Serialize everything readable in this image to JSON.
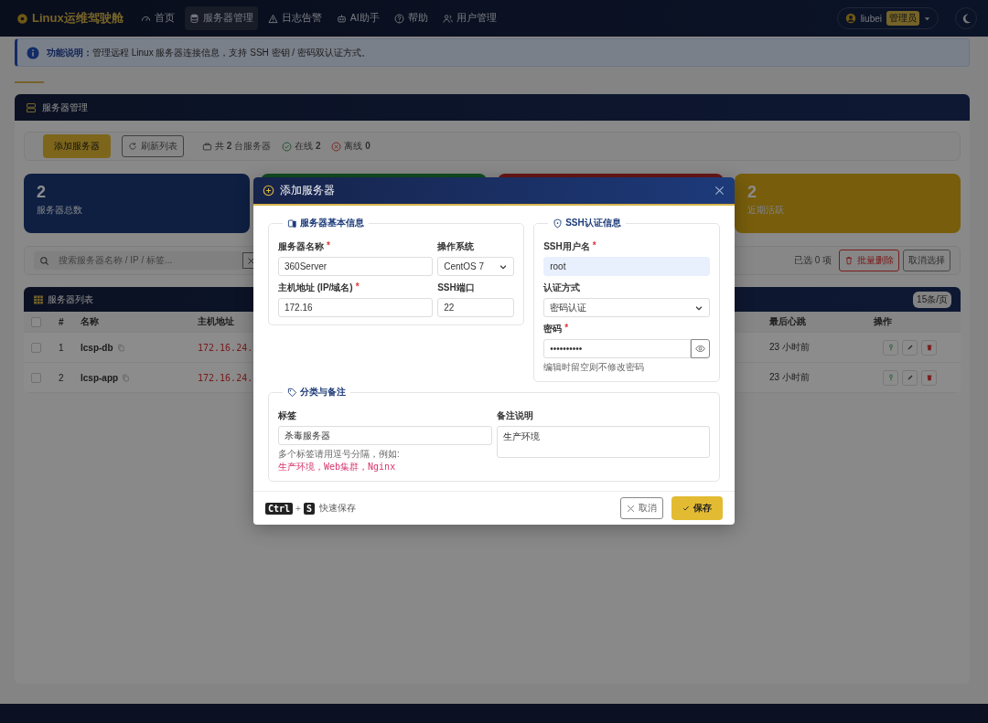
{
  "navbar": {
    "brand": "Linux运维驾驶舱",
    "items": [
      {
        "label": "首页",
        "selected": false
      },
      {
        "label": "服务器管理",
        "selected": true
      },
      {
        "label": "日志告警",
        "selected": false
      },
      {
        "label": "AI助手",
        "selected": false
      },
      {
        "label": "帮助",
        "selected": false
      },
      {
        "label": "用户管理",
        "selected": false
      }
    ],
    "user": {
      "name": "liubei",
      "role": "管理员"
    }
  },
  "alert": {
    "label": "功能说明：",
    "text": "管理远程 Linux 服务器连接信息，支持 SSH 密钥 / 密码双认证方式。"
  },
  "panel": {
    "title": "服务器管理"
  },
  "toolbar": {
    "add_button": "添加服务器",
    "refresh_button": "刷新列表",
    "stats": [
      {
        "kind": "total",
        "text": "共 **2** 台服务器"
      },
      {
        "kind": "online",
        "text": "在线 **2**"
      },
      {
        "kind": "offline",
        "text": "离线 **0**"
      }
    ]
  },
  "stat_cards": [
    {
      "kind": "total",
      "value": "2",
      "label": "服务器总数"
    },
    {
      "kind": "online"
    },
    {
      "kind": "offline"
    },
    {
      "kind": "active",
      "value": "2",
      "label": "近期活跃"
    }
  ],
  "search": {
    "placeholder": "搜索服务器名称 / IP / 标签..."
  },
  "selection": {
    "text": "已选 0 项",
    "delete_button": "批量删除",
    "clear_button": "取消选择"
  },
  "table": {
    "title": "服务器列表",
    "page_size": "15条/页",
    "select_all_checked": false,
    "columns": [
      "#",
      "名称",
      "主机地址",
      "最后心跳",
      "操作"
    ],
    "rows": [
      {
        "checked": false,
        "index": "1",
        "name": "lcsp-db",
        "host": "172.16.24.",
        "heartbeat": "23 小时前"
      },
      {
        "checked": false,
        "index": "2",
        "name": "lcsp-app",
        "host": "172.16.24.",
        "heartbeat": "23 小时前"
      }
    ]
  },
  "modal": {
    "title": "添加服务器",
    "basic": {
      "legend": "服务器基本信息",
      "fields": [
        {
          "kind": "text",
          "label": "服务器名称",
          "required_mark": "*",
          "value": "360Server"
        },
        {
          "kind": "select",
          "label": "操作系统",
          "value": "CentOS 7"
        },
        {
          "kind": "text",
          "label": "主机地址 (IP/域名)",
          "required_mark": "*",
          "value": "172.16"
        },
        {
          "kind": "text",
          "label": "SSH端口",
          "value": "22"
        }
      ]
    },
    "ssh": {
      "legend": "SSH认证信息",
      "fields": [
        {
          "kind": "autofilled",
          "label": "SSH用户名",
          "required_mark": "*",
          "value": "root"
        },
        {
          "kind": "select",
          "label": "认证方式",
          "value": "密码认证"
        },
        {
          "kind": "password",
          "label": "密码",
          "required_mark": "*",
          "value": "••••••••••",
          "hint": "编辑时留空则不修改密码"
        }
      ]
    },
    "notes": {
      "legend": "分类与备注",
      "fields": [
        {
          "kind": "text",
          "label": "标签",
          "value": "杀毒服务器",
          "hint": "多个标签请用逗号分隔，例如: ",
          "hint_example": "生产环境，Web集群，Nginx"
        },
        {
          "kind": "textarea",
          "label": "备注说明",
          "value": "生产环境"
        }
      ]
    },
    "shortcut": {
      "keys": [
        "Ctrl",
        "S"
      ],
      "joiner": "+",
      "text": "快速保存"
    },
    "cancel_button": "取消",
    "save_button": "保存"
  }
}
